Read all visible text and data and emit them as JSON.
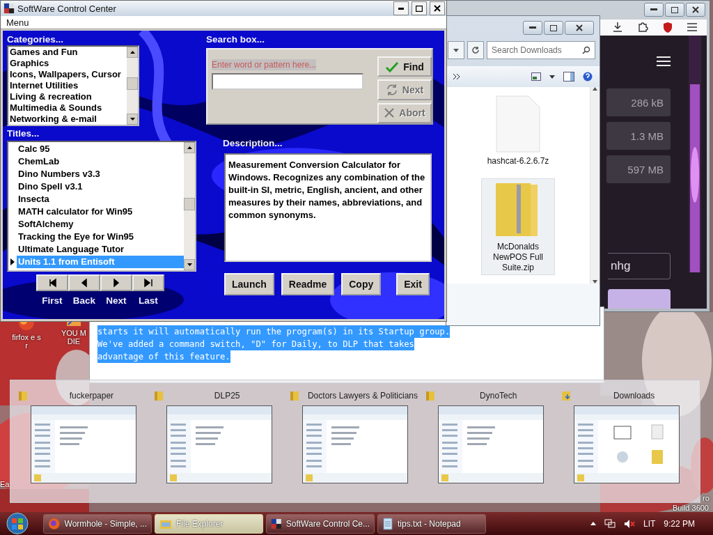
{
  "desktop": {
    "icons": [
      {
        "label": "firfox e s r",
        "kind": "browser"
      },
      {
        "label": "YOU M DIE",
        "kind": "shortcut"
      }
    ],
    "edge_texts": [
      "Ea",
      "ro",
      "Build 3600"
    ]
  },
  "browser": {
    "sizes": [
      "286 kB",
      "1.3 MB",
      "597 MB"
    ],
    "input_value": "nhg"
  },
  "explorer": {
    "search": {
      "placeholder": "Search Downloads"
    },
    "files": [
      {
        "name": "hashcat-6.2.6.7z",
        "kind": "file",
        "selected": false
      },
      {
        "name": "McDonalds NewPOS Full Suite.zip",
        "kind": "zip",
        "selected": true
      }
    ]
  },
  "notepad": {
    "lines": [
      {
        "text": "starts it will automatically run the program(s) in its Startup group.",
        "highlighted": true
      },
      {
        "text": "We've added a command switch, \"D\" for Daily, to DLP that takes",
        "highlighted": true
      },
      {
        "text": "advantage of this feature.",
        "highlighted": true
      }
    ]
  },
  "control_center": {
    "title": "SoftWare Control Center",
    "menu": [
      "Menu"
    ],
    "categories": {
      "label": "Categories...",
      "items": [
        "Games and Fun",
        "Graphics",
        "Icons, Wallpapers, Cursor",
        "Internet Utilities",
        "Living & recreation",
        "Multimedia & Sounds",
        "Networking & e-mail"
      ]
    },
    "titles": {
      "label": "Titles...",
      "items": [
        {
          "text": "Calc 95",
          "selected": false
        },
        {
          "text": "ChemLab",
          "selected": false
        },
        {
          "text": "Dino Numbers v3.3",
          "selected": false
        },
        {
          "text": "Dino Spell v3.1",
          "selected": false
        },
        {
          "text": "Insecta",
          "selected": false
        },
        {
          "text": "MATH calculator for Win95",
          "selected": false
        },
        {
          "text": "SoftAlchemy",
          "selected": false
        },
        {
          "text": "Tracking the Eye for Win95",
          "selected": false
        },
        {
          "text": "Ultimate Language Tutor",
          "selected": false
        },
        {
          "text": "Units 1.1 from Entisoft",
          "selected": true
        }
      ]
    },
    "nav": [
      {
        "kind": "first",
        "label": "First"
      },
      {
        "kind": "back",
        "label": "Back"
      },
      {
        "kind": "next",
        "label": "Next"
      },
      {
        "kind": "last",
        "label": "Last"
      }
    ],
    "search": {
      "label": "Search box...",
      "placeholder": "Enter word or pattern here..."
    },
    "search_buttons": [
      {
        "label": "Find",
        "kind": "check",
        "disabled": false
      },
      {
        "label": "Next",
        "kind": "refresh",
        "disabled": true
      },
      {
        "label": "Abort",
        "kind": "cross",
        "disabled": true
      }
    ],
    "description": {
      "label": "Description...",
      "text": "Measurement Conversion Calculator for Windows. Recognizes any combination of the built-in SI, metric, English, ancient, and other measures by their names, abbreviations, and common synonyms."
    },
    "actions": [
      "Launch",
      "Readme",
      "Copy",
      "Exit"
    ]
  },
  "switcher": {
    "items": [
      {
        "title": "fuckerpaper",
        "kind": "folder"
      },
      {
        "title": "DLP25",
        "kind": "folder"
      },
      {
        "title": "Doctors Lawyers & Politicians",
        "kind": "folder"
      },
      {
        "title": "DynoTech",
        "kind": "folder"
      },
      {
        "title": "Downloads",
        "kind": "downloads"
      }
    ]
  },
  "taskbar": {
    "tasks": [
      {
        "title": "Wormhole - Simple, ...",
        "kind": "browser",
        "selected": false
      },
      {
        "title": "File Explorer",
        "kind": "explorer",
        "selected": true
      },
      {
        "title": "SoftWare Control Ce...",
        "kind": "app",
        "selected": false
      },
      {
        "title": "tips.txt - Notepad",
        "kind": "notepad",
        "selected": false
      }
    ],
    "language": "LIT",
    "time": "9:22 PM"
  }
}
